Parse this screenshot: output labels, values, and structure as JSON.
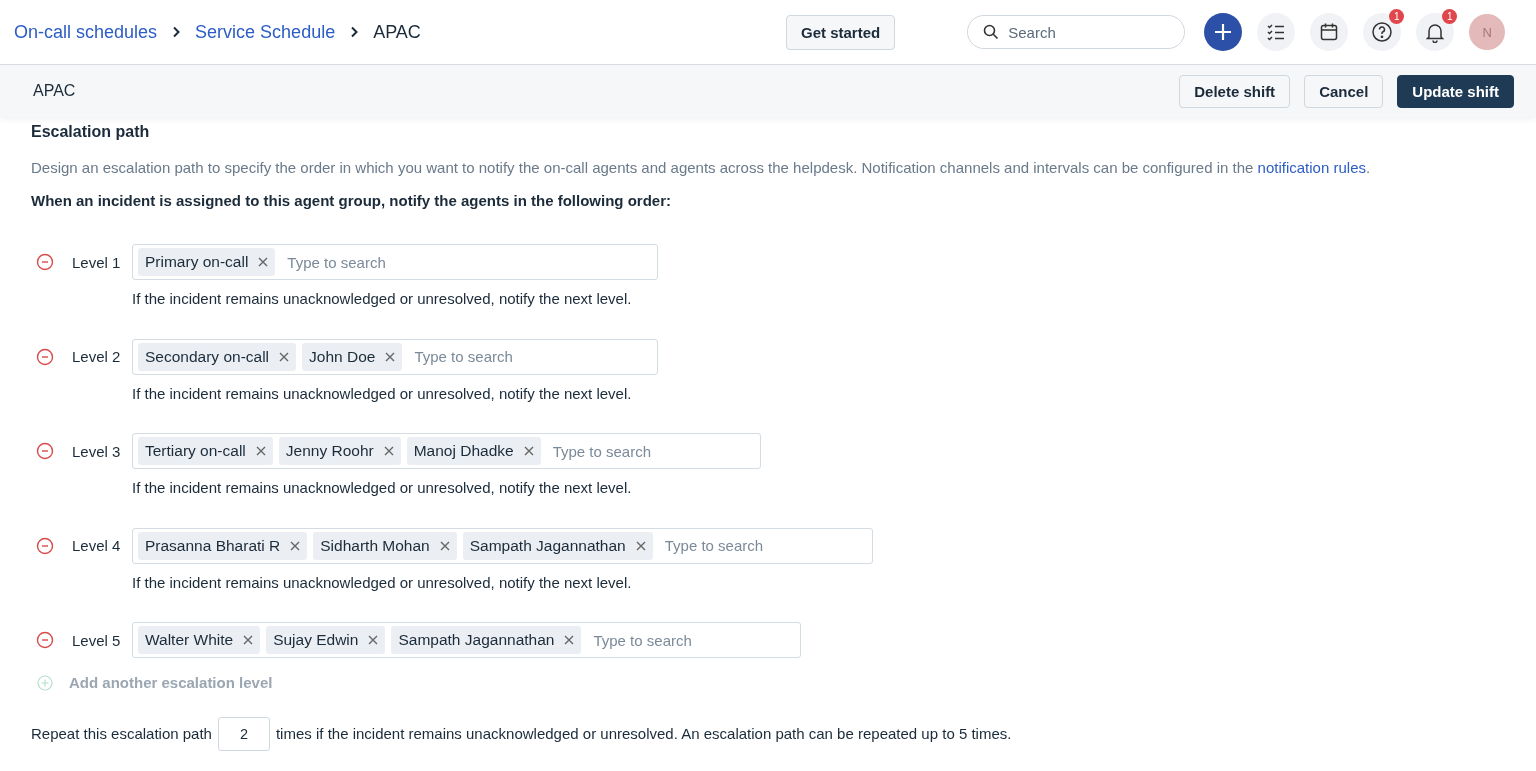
{
  "breadcrumbs": [
    {
      "label": "On-call schedules",
      "current": false
    },
    {
      "label": "Service Schedule",
      "current": false
    },
    {
      "label": "APAC",
      "current": true
    }
  ],
  "topbar": {
    "get_started": "Get started",
    "search": {
      "placeholder": "Search"
    },
    "help_badge": "1",
    "notifications_badge": "1",
    "avatar": "N"
  },
  "header": {
    "title": "APAC",
    "buttons": [
      {
        "label": "Delete shift",
        "kind": "secondary"
      },
      {
        "label": "Cancel",
        "kind": "secondary"
      },
      {
        "label": "Update shift",
        "kind": "primary"
      }
    ]
  },
  "escalation": {
    "title": "Escalation path",
    "description": "Design an escalation path to specify the order in which you want to notify the on-call agents and agents across the helpdesk. Notification channels and intervals can be configured in the ",
    "description_link": "notification rules",
    "description_end": ".",
    "instruction": "When an incident is assigned to this agent group, notify the agents in the following order:",
    "levels": [
      {
        "label": "Level 1",
        "agents": [
          "Primary on-call"
        ],
        "placeholder": "Type to search",
        "hint": "If the incident remains unacknowledged or unresolved, notify the next level."
      },
      {
        "label": "Level 2",
        "agents": [
          "Secondary on-call",
          "John Doe"
        ],
        "placeholder": "Type to search",
        "hint": "If the incident remains unacknowledged or unresolved, notify the next level."
      },
      {
        "label": "Level 3",
        "agents": [
          "Tertiary on-call",
          "Jenny Roohr",
          "Manoj Dhadke"
        ],
        "placeholder": "Type to search",
        "hint": "If the incident remains unacknowledged or unresolved, notify the next level."
      },
      {
        "label": "Level 4",
        "agents": [
          "Prasanna Bharati R",
          "Sidharth Mohan",
          "Sampath Jagannathan"
        ],
        "placeholder": "Type to search",
        "hint": "If the incident remains unacknowledged or unresolved, notify the next level."
      },
      {
        "label": "Level 5",
        "agents": [
          "Walter White",
          "Sujay Edwin",
          "Sampath Jagannathan"
        ],
        "placeholder": "Type to search"
      }
    ],
    "add_level": {
      "label": "Add another escalation level",
      "disabled": true
    },
    "repeat": {
      "before": "Repeat this escalation path",
      "value": "2",
      "after": "times if the incident remains unacknowledged or unresolved. An escalation path can be repeated up to 5 times."
    }
  }
}
